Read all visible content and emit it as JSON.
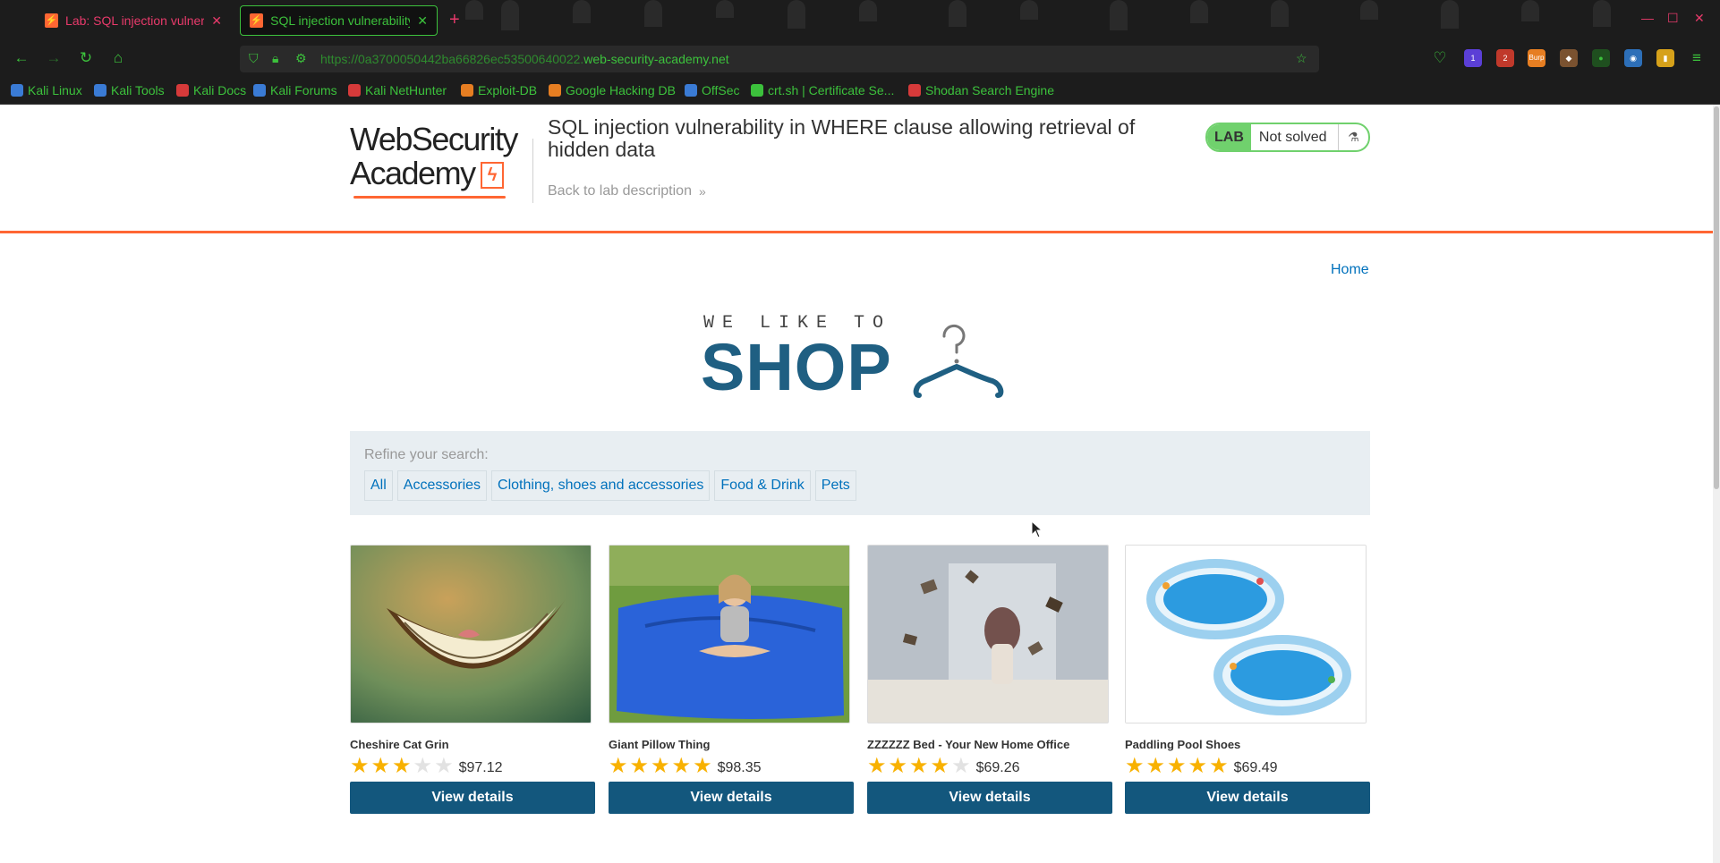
{
  "browser": {
    "tabs": [
      {
        "title": "Lab: SQL injection vulnerab"
      },
      {
        "title": "SQL injection vulnerability i"
      }
    ],
    "new_tab": "+",
    "close": "✕",
    "url_prefix": "https://0a3700050442ba66826ec53500640022.",
    "url_domain": "web-security-academy.net",
    "extensions": [
      {
        "name": "ext-badge-1",
        "label": "1",
        "color": "#5b3fd6"
      },
      {
        "name": "ext-badge-2",
        "label": "2",
        "color": "#c0392b"
      },
      {
        "name": "ext-burp",
        "label": "Burp",
        "color": "#e67e22"
      }
    ],
    "bookmarks": [
      {
        "label": "Kali Linux",
        "color": "#3a7bd5"
      },
      {
        "label": "Kali Tools",
        "color": "#3a7bd5"
      },
      {
        "label": "Kali Docs",
        "color": "#d63a3a"
      },
      {
        "label": "Kali Forums",
        "color": "#3a7bd5"
      },
      {
        "label": "Kali NetHunter",
        "color": "#d63a3a"
      },
      {
        "label": "Exploit-DB",
        "color": "#e67e22"
      },
      {
        "label": "Google Hacking DB",
        "color": "#e67e22"
      },
      {
        "label": "OffSec",
        "color": "#3a7bd5"
      },
      {
        "label": "crt.sh | Certificate Se...",
        "color": "#3cc13c"
      },
      {
        "label": "Shodan Search Engine",
        "color": "#d63a3a"
      }
    ]
  },
  "lab": {
    "logo_line1": "WebSecurity",
    "logo_line2": "Academy",
    "title": "SQL injection vulnerability in WHERE clause allowing retrieval of hidden data",
    "back_link": "Back to lab description",
    "status_tag": "LAB",
    "status": "Not solved"
  },
  "nav": {
    "home": "Home"
  },
  "shop_logo": {
    "line1": "WE LIKE TO",
    "line2": "SHOP"
  },
  "filter": {
    "label": "Refine your search:",
    "categories": [
      "All",
      "Accessories",
      "Clothing, shoes and accessories",
      "Food & Drink",
      "Pets"
    ]
  },
  "products": [
    {
      "name": "Cheshire Cat Grin",
      "price": "$97.12",
      "rating": 3,
      "button": "View details"
    },
    {
      "name": "Giant Pillow Thing",
      "price": "$98.35",
      "rating": 5,
      "button": "View details"
    },
    {
      "name": "ZZZZZZ Bed - Your New Home Office",
      "price": "$69.26",
      "rating": 4,
      "button": "View details"
    },
    {
      "name": "Paddling Pool Shoes",
      "price": "$69.49",
      "rating": 5,
      "button": "View details"
    }
  ],
  "colors": {
    "accent": "#ff6633",
    "link": "#0071bc",
    "button": "#13577d",
    "lab_green": "#70d16d",
    "star": "#f8b100"
  }
}
